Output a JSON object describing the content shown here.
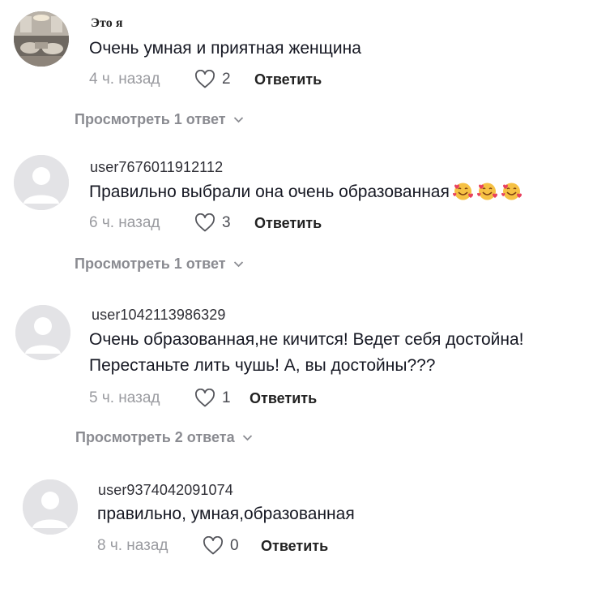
{
  "comments": [
    {
      "username": "Это я",
      "text": "Очень умная и приятная женщина",
      "time": "4 ч. назад",
      "likes": "2",
      "reply_label": "Ответить",
      "view_replies": "Просмотреть 1 ответ",
      "avatar": "photo"
    },
    {
      "username": "user7676011912112",
      "text": "Правильно выбрали она очень образованная",
      "emojis": [
        "smiling-face-with-hearts",
        "smiling-face-with-hearts",
        "smiling-face-with-hearts"
      ],
      "time": "6 ч. назад",
      "likes": "3",
      "reply_label": "Ответить",
      "view_replies": "Просмотреть 1 ответ",
      "avatar": "default"
    },
    {
      "username": "user1042113986329",
      "text_lines": [
        "Очень образованная,не кичится! Ведет себя достойна!",
        "Перестаньте лить чушь! А, вы достойны???"
      ],
      "time": "5 ч. назад",
      "likes": "1",
      "reply_label": "Ответить",
      "view_replies": "Просмотреть 2 ответа",
      "avatar": "default"
    },
    {
      "username": "user9374042091074",
      "text": "правильно, умная,образованная",
      "time": "8 ч. назад",
      "likes": "0",
      "reply_label": "Ответить",
      "avatar": "default"
    }
  ],
  "colors": {
    "text": "#161823",
    "muted": "#9a9ba0",
    "avatar_bg": "#e3e3e6",
    "avatar_fg": "#ffffff"
  }
}
